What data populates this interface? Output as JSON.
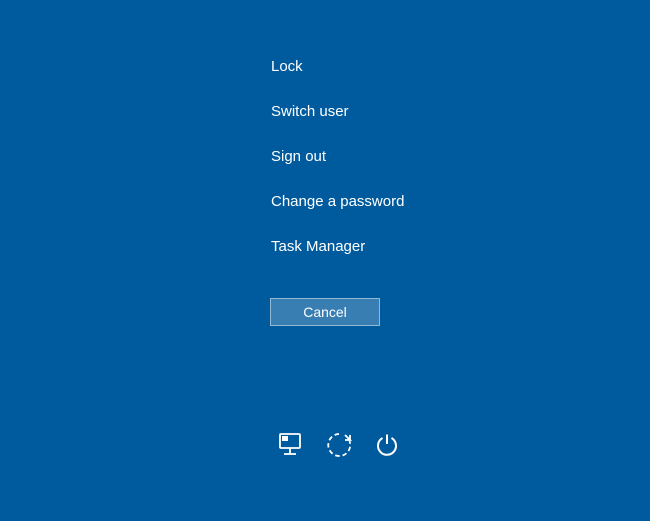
{
  "menu": {
    "items": [
      {
        "label": "Lock"
      },
      {
        "label": "Switch user"
      },
      {
        "label": "Sign out"
      },
      {
        "label": "Change a password"
      },
      {
        "label": "Task Manager"
      }
    ]
  },
  "cancel_label": "Cancel",
  "icons": {
    "network": "network-icon",
    "ease_of_access": "ease-of-access-icon",
    "power": "power-icon"
  }
}
